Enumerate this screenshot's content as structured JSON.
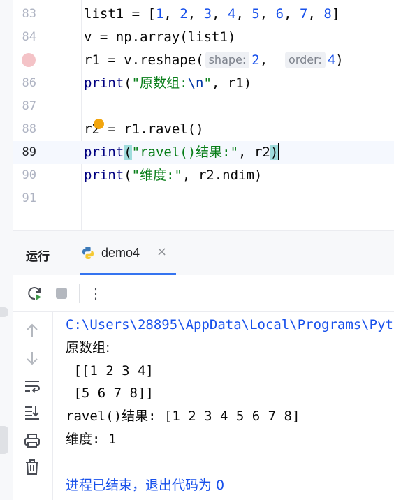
{
  "editor": {
    "lines": [
      {
        "num": "83",
        "tokens": [
          "list1 = [",
          "1",
          ", ",
          "2",
          ", ",
          "3",
          ", ",
          "4",
          ", ",
          "5",
          ", ",
          "6",
          ", ",
          "7",
          ", ",
          "8",
          "]"
        ]
      },
      {
        "num": "84",
        "tokens": [
          "v = np.array(list1)"
        ]
      },
      {
        "num": "",
        "tokens": [
          "r1 = v.reshape(",
          "shape:",
          "2",
          ",  ",
          "order:",
          "4",
          ")"
        ]
      },
      {
        "num": "86",
        "tokens": [
          "print",
          "(",
          "\"原数组:",
          "\\n",
          "\"",
          ", r1)"
        ]
      },
      {
        "num": "87",
        "tokens": []
      },
      {
        "num": "88",
        "tokens": [
          "r2 = r1.ravel()"
        ]
      },
      {
        "num": "89",
        "tokens": [
          "print",
          "(",
          "\"ravel()结果:\"",
          ", r2",
          ")"
        ]
      },
      {
        "num": "90",
        "tokens": [
          "print",
          "(",
          "\"维度:\"",
          ", r2.ndim)"
        ]
      },
      {
        "num": "91",
        "tokens": []
      }
    ]
  },
  "run_panel": {
    "title": "运行",
    "tab": {
      "label": "demo4",
      "icon": "python-icon",
      "close": "×"
    },
    "toolbar": {
      "rerun": "rerun-icon",
      "stop": "stop-icon",
      "more": "⋮"
    },
    "side_icons": [
      "arrow-up-icon",
      "arrow-down-icon",
      "soft-wrap-icon",
      "scroll-to-end-icon",
      "print-icon",
      "trash-icon"
    ]
  },
  "console": {
    "lines": [
      "C:\\Users\\28895\\AppData\\Local\\Programs\\Pyt",
      "原数组:",
      " [[1 2 3 4]",
      " [5 6 7 8]]",
      "ravel()结果: [1 2 3 4 5 6 7 8]",
      "维度: 1",
      "",
      "进程已结束，退出代码为 0"
    ]
  },
  "colors": {
    "number": "#1750eb",
    "string": "#067d17",
    "keyword_fn": "#000080",
    "accent": "#3574f0",
    "breakpoint": "#f4c3c7"
  }
}
